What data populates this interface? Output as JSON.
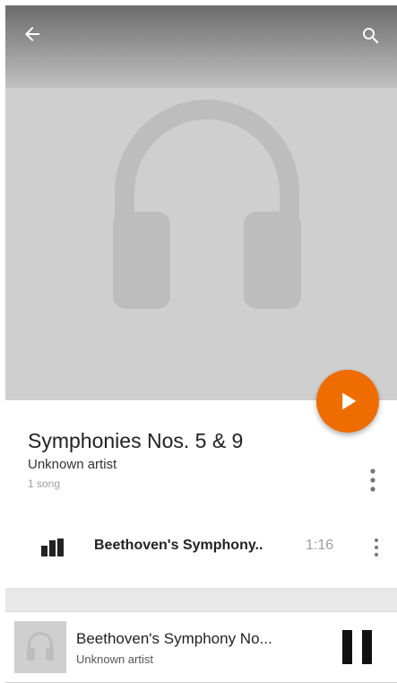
{
  "header": {
    "back_icon": "arrow-back-icon",
    "search_icon": "search-icon",
    "art_placeholder_icon": "headphones-icon"
  },
  "play_fab": {
    "icon": "play-icon",
    "color": "#ef6c00"
  },
  "album": {
    "title": "Symphonies Nos. 5 & 9",
    "artist": "Unknown artist",
    "song_count": "1 song"
  },
  "tracks": [
    {
      "title": "Beethoven's Symphony..",
      "duration": "1:16",
      "playing": true
    }
  ],
  "now_playing": {
    "title": "Beethoven's Symphony No...",
    "artist": "Unknown artist",
    "state_icon": "pause-icon"
  }
}
